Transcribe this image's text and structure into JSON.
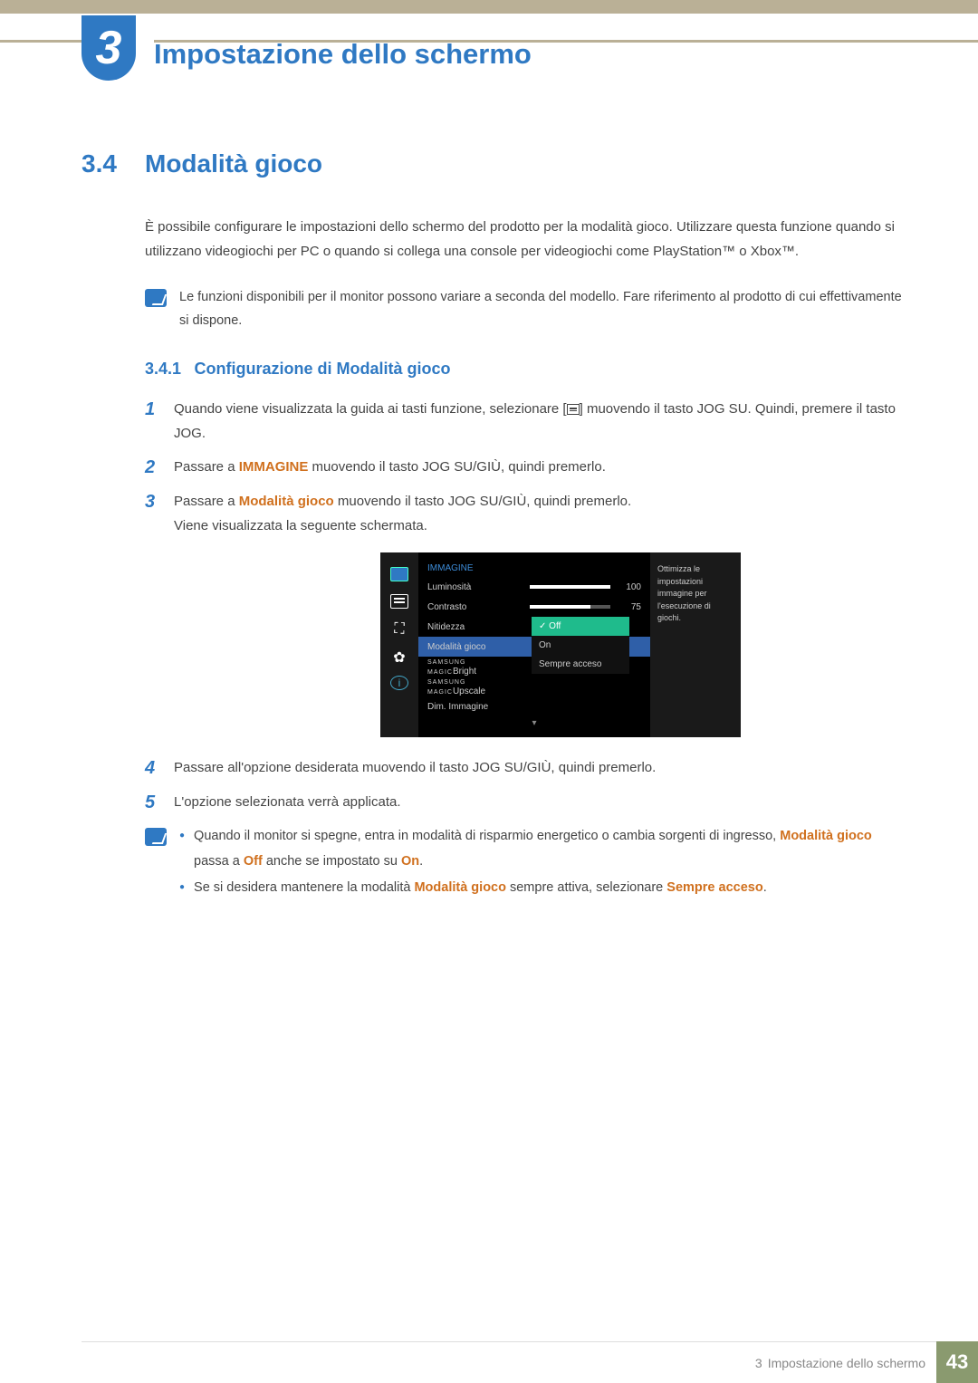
{
  "chapter": {
    "number": "3",
    "title": "Impostazione dello schermo"
  },
  "section": {
    "number": "3.4",
    "title": "Modalità gioco"
  },
  "intro": "È possibile configurare le impostazioni dello schermo del prodotto per la modalità gioco. Utilizzare questa funzione quando si utilizzano videogiochi per PC o quando si collega una console per videogiochi come PlayStation™ o Xbox™.",
  "note1": "Le funzioni disponibili per il monitor possono variare a seconda del modello. Fare riferimento al prodotto di cui effettivamente si dispone.",
  "subsection": {
    "number": "3.4.1",
    "title": "Configurazione di Modalità gioco"
  },
  "steps": {
    "s1a": "Quando viene visualizzata la guida ai tasti funzione, selezionare [",
    "s1b": "] muovendo il tasto JOG SU. Quindi, premere il tasto JOG.",
    "s2a": "Passare a ",
    "s2_bold": "IMMAGINE",
    "s2b": " muovendo il tasto JOG SU/GIÙ, quindi premerlo.",
    "s3a": "Passare a ",
    "s3_bold": "Modalità gioco",
    "s3b": " muovendo il tasto JOG SU/GIÙ, quindi premerlo.",
    "s3c": "Viene visualizzata la seguente schermata.",
    "s4": "Passare all'opzione desiderata muovendo il tasto JOG SU/GIÙ, quindi premerlo.",
    "s5": "L'opzione selezionata verrà applicata."
  },
  "osd": {
    "title": "IMMAGINE",
    "rows": {
      "luminosita": "Luminosità",
      "lum_val": "100",
      "contrasto": "Contrasto",
      "con_val": "75",
      "nitidezza": "Nitidezza",
      "modalita": "Modalità gioco",
      "bright": "Bright",
      "bright_pre": "SAMSUNG",
      "bright_magic": "MAGIC",
      "upscale": "Upscale",
      "upscale_pre": "SAMSUNG",
      "upscale_magic": "MAGIC",
      "dim": "Dim. Immagine"
    },
    "submenu": {
      "off": "Off",
      "on": "On",
      "sempre": "Sempre acceso"
    },
    "desc": "Ottimizza le impostazioni immagine per l'esecuzione di giochi."
  },
  "note2": {
    "b1a": "Quando il monitor si spegne, entra in modalità di risparmio energetico o cambia sorgenti di ingresso, ",
    "b1_bold1": "Modalità gioco",
    "b1b": " passa a ",
    "b1_bold2": "Off",
    "b1c": " anche se impostato su ",
    "b1_bold3": "On",
    "b1d": ".",
    "b2a": "Se si desidera mantenere la modalità ",
    "b2_bold1": "Modalità gioco",
    "b2b": " sempre attiva, selezionare ",
    "b2_bold2": "Sempre acceso",
    "b2c": "."
  },
  "footer": {
    "chapnum": "3",
    "chaptitle": "Impostazione dello schermo",
    "page": "43"
  }
}
